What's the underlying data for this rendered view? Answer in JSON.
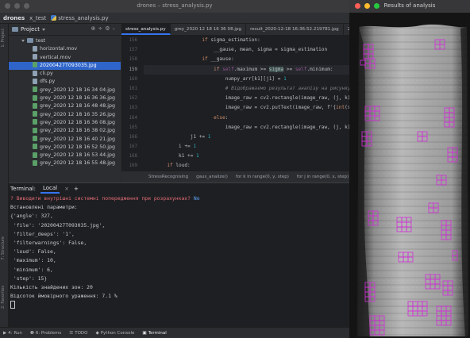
{
  "ide": {
    "title": "drones – stress_analysis.py",
    "nav": {
      "project": "drones",
      "folder": "x_test",
      "file": "stress_analysis.py"
    },
    "side_tabs": {
      "project": "1: Project",
      "structure": "7: Structure",
      "favorites": "2: Favorites"
    },
    "project_panel": {
      "header": "Project",
      "items": [
        {
          "label": "test",
          "type": "folder"
        },
        {
          "label": "horizontal.mov",
          "type": "file"
        },
        {
          "label": "vertical.mov",
          "type": "file"
        },
        {
          "label": "20200427T093035.jpg",
          "type": "image",
          "selected": true
        },
        {
          "label": "cli.py",
          "type": "file"
        },
        {
          "label": "dfs.py",
          "type": "file"
        },
        {
          "label": "grey_2020 12 18 16 34 04.jpg",
          "type": "image"
        },
        {
          "label": "grey_2020 12 18 16 36 36.jpg",
          "type": "image"
        },
        {
          "label": "grey_2020 12 18 16 48 48.jpg",
          "type": "image"
        },
        {
          "label": "grey_2020 12 18 16 35 26.jpg",
          "type": "image"
        },
        {
          "label": "grey_2020 12 18 16 36 08.jpg",
          "type": "image"
        },
        {
          "label": "grey_2020 12 18 16 38 02.jpg",
          "type": "image"
        },
        {
          "label": "grey_2020 12 18 16 40 21.jpg",
          "type": "image"
        },
        {
          "label": "grey_2020 12 18 16 52 50.jpg",
          "type": "image"
        },
        {
          "label": "grey_2020 12 18 16 53 44.jpg",
          "type": "image"
        },
        {
          "label": "grey_2020 12 18 16 55 48.jpg",
          "type": "image"
        }
      ]
    },
    "editor": {
      "tabs": [
        {
          "label": "stress_analysis.py",
          "active": true
        },
        {
          "label": "grey_2020 12 18 16 36 08.jpg",
          "active": false
        },
        {
          "label": "result_2020-12-18 16:36:52.219781.jpg",
          "active": false
        },
        {
          "label": "2020",
          "active": false
        }
      ],
      "line_numbers": [
        "156",
        "157",
        "158",
        "159",
        "160",
        "161",
        "162",
        "163",
        "164",
        "165",
        "166",
        "167",
        "168",
        "169"
      ],
      "current_line_index": 3,
      "breadcrumbs": [
        "StressRecognising",
        "gaus_analize()",
        "for k in range(0, y, step)",
        "for j in range(0, x, step)",
        "if __"
      ]
    },
    "terminal": {
      "label": "Terminal:",
      "tab": "Local",
      "add": "+",
      "question": "? Виводити внутрішні системні попередження при розрахунках?",
      "answer": "No",
      "lines": [
        "Встановлені параметри:",
        "{'angle': 327,",
        " 'file': '20200427T093035.jpg',",
        " 'filter_deeps': '1',",
        " 'filterwarnings': False,",
        " 'loud': False,",
        " 'maximum': 10,",
        " 'minimum': 6,",
        " 'step': 15}",
        "Кількість знайдених зон: 20",
        "Відсоток ймовірного ураження: 7.1 %"
      ]
    },
    "statusbar": [
      "4: Run",
      "6: Problems",
      "TODO",
      "Python Console",
      "Terminal"
    ]
  },
  "results_window": {
    "title": "Results of analysis"
  },
  "colors": {
    "accent": "#3574f0",
    "box": "#d12ed8",
    "selection": "#2f65ca"
  }
}
